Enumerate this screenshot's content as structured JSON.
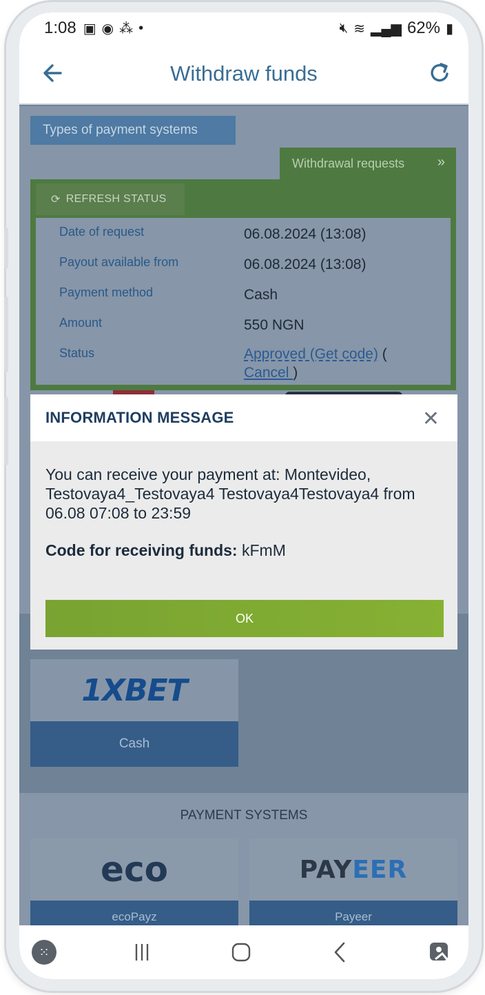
{
  "status_bar": {
    "time": "1:08",
    "battery": "62%"
  },
  "header": {
    "title": "Withdraw funds"
  },
  "types_button": "Types of payment systems",
  "withdrawal_tab": {
    "label": "Withdrawal requests"
  },
  "refresh_status": "REFRESH STATUS",
  "request": {
    "rows": [
      {
        "label": "Date of request",
        "value": "06.08.2024 (13:08)"
      },
      {
        "label": "Payout available from",
        "value": "06.08.2024 (13:08)"
      },
      {
        "label": "Payment method",
        "value": "Cash"
      },
      {
        "label": "Amount",
        "value": "550 NGN"
      }
    ],
    "status_label": "Status",
    "status_link": "Approved (Get code)",
    "status_open": " (",
    "cancel_link": "Cancel ",
    "status_close": ")"
  },
  "modal": {
    "title": "INFORMATION MESSAGE",
    "message": "You can receive your payment at: Montevideo, Testovaya4_Testovaya4 Testovaya4Testovaya4 from 06.08 07:08 to 23:59",
    "code_label": "Code for receiving funds:",
    "code_value": "kFmM",
    "ok_label": "OK"
  },
  "cash_card": {
    "logo": "1XBET",
    "label": "Cash"
  },
  "payment_systems": {
    "title": "PAYMENT SYSTEMS",
    "items": [
      {
        "logo": "eco",
        "label": "ecoPayz"
      },
      {
        "logo_a": "PAY",
        "logo_b": "EER",
        "label": "Payeer"
      }
    ]
  }
}
